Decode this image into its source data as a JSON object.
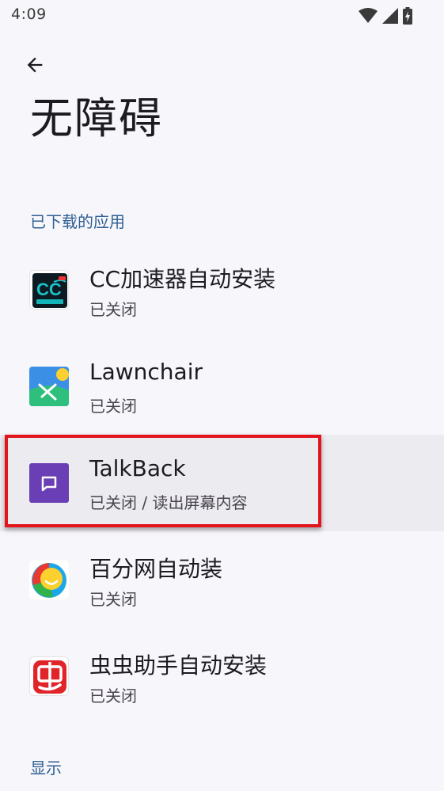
{
  "status_bar": {
    "time": "4:09",
    "icons": [
      "wifi-icon",
      "signal-icon",
      "battery-charging-icon"
    ]
  },
  "header": {
    "back_icon": "arrow-back-icon",
    "title": "无障碍"
  },
  "sections": [
    {
      "title": "已下载的应用",
      "items": [
        {
          "name": "CC加速器自动安装",
          "status": "已关闭",
          "icon": "cc-accelerator-icon"
        },
        {
          "name": "Lawnchair",
          "status": "已关闭",
          "icon": "lawnchair-icon"
        },
        {
          "name": "TalkBack",
          "status": "已关闭 / 读出屏幕内容",
          "icon": "talkback-icon"
        },
        {
          "name": "百分网自动装",
          "status": "已关闭",
          "icon": "baifenwang-icon"
        },
        {
          "name": "虫虫助手自动安装",
          "status": "已关闭",
          "icon": "chongchong-icon"
        }
      ]
    },
    {
      "title": "显示",
      "items": []
    }
  ],
  "colors": {
    "background": "#f7f6fa",
    "section_header": "#2e5f95",
    "selected_row": "#ecebef",
    "highlight_border": "#e2141c",
    "talkback_purple": "#6a3fb5"
  }
}
